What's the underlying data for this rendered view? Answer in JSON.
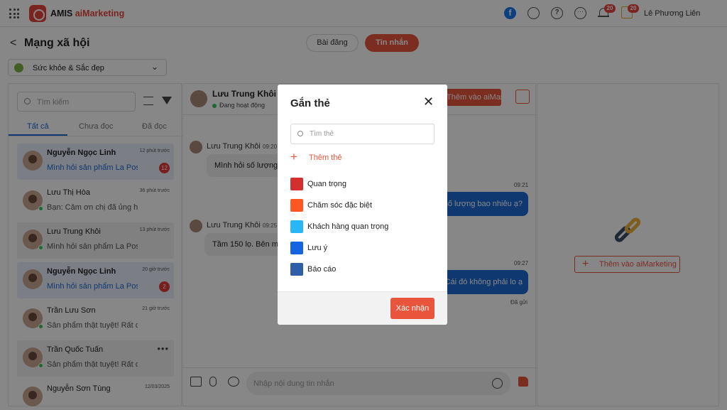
{
  "topbar": {
    "brand_main": "AMIS ",
    "brand_accent": "aiMarketing",
    "facebook_glyph": "f",
    "help_glyph": "?",
    "more_glyph": "···",
    "notif_count": "20",
    "gift_count": "20",
    "user_name": "Lê Phương Liên"
  },
  "header": {
    "back_glyph": "<",
    "title": "Mạng xã hội",
    "tabs": [
      {
        "label": "Bài đăng"
      },
      {
        "label": "Tin nhắn"
      }
    ],
    "category": "Sức khỏe & Sắc đẹp",
    "category_chevron": "⌄"
  },
  "inbox": {
    "search_placeholder": "Tìm kiếm",
    "tabs": [
      {
        "label": "Tất cả"
      },
      {
        "label": "Chưa đọc"
      },
      {
        "label": "Đã đọc"
      }
    ],
    "conversations": [
      {
        "name": "Nguyễn Ngọc Linh",
        "time": "12 phút trước",
        "message": "Mình hỏi sản phẩm La Poss",
        "unread": "12"
      },
      {
        "name": "Lưu Thị Hòa",
        "time": "36 phút trước",
        "message": "Bạn: Cảm ơn chị đã ủng hộ"
      },
      {
        "name": "Lưu Trung Khôi",
        "time": "13 phút trước",
        "message": "Mình hỏi sản phẩm La Poss"
      },
      {
        "name": "Nguyễn Ngọc Linh",
        "time": "20 giờ trước",
        "message": "Mình hỏi sản phẩm La Poss",
        "unread": "2"
      },
      {
        "name": "Trần Lưu Sơn",
        "time": "21 giờ trước",
        "message": "Sản phẩm thật tuyệt! Rất cảm"
      },
      {
        "name": "Trần Quốc Tuấn",
        "menu": "•••",
        "message": "Sản phẩm thật tuyệt! Rất cảm"
      },
      {
        "name": "Nguyễn Sơn Tùng",
        "time": "12/03/2025",
        "message": ""
      }
    ]
  },
  "chat": {
    "contact_name": "Lưu Trung Khôi",
    "contact_status": "Đang hoạt động",
    "add_button": "Thêm vào aiMarketing",
    "messages": [
      {
        "sender": "Lưu Trung Khôi",
        "time": "09:20",
        "text": "Mình hỏi số lượng sản phẩm"
      },
      {
        "time": "09:21",
        "text": "Dạ, chị hỏi số lượng bao nhiêu ạ?"
      },
      {
        "sender": "Lưu Trung Khôi",
        "time": "09:25",
        "text": "Tầm 150 lọ. Bên mình có không?"
      },
      {
        "time": "09:27",
        "text": "Cái đó không phải lo ạ"
      }
    ],
    "sent_label": "Đã gửi",
    "composer_placeholder": "Nhập nội dung tin nhắn"
  },
  "side_panel": {
    "add_button": "Thêm vào aiMarketing",
    "plus_glyph": "+"
  },
  "modal": {
    "title": "Gắn thẻ",
    "close_glyph": "✕",
    "search_placeholder": "Tìm thẻ",
    "add_tag_label": "Thêm thẻ",
    "plus_glyph": "+",
    "tags": [
      {
        "label": "Quan trọng",
        "color": "#d32f2f"
      },
      {
        "label": "Chăm sóc đặc biệt",
        "color": "#ff5722"
      },
      {
        "label": "Khách hàng quan trọng",
        "color": "#29b6f6"
      },
      {
        "label": "Lưu ý",
        "color": "#1565e0"
      },
      {
        "label": "Báo cáo",
        "color": "#2e5fa8"
      }
    ],
    "confirm_label": "Xác nhận"
  },
  "colors": {
    "accent": "#e8553c",
    "primary_blue": "#1e6bd6"
  }
}
